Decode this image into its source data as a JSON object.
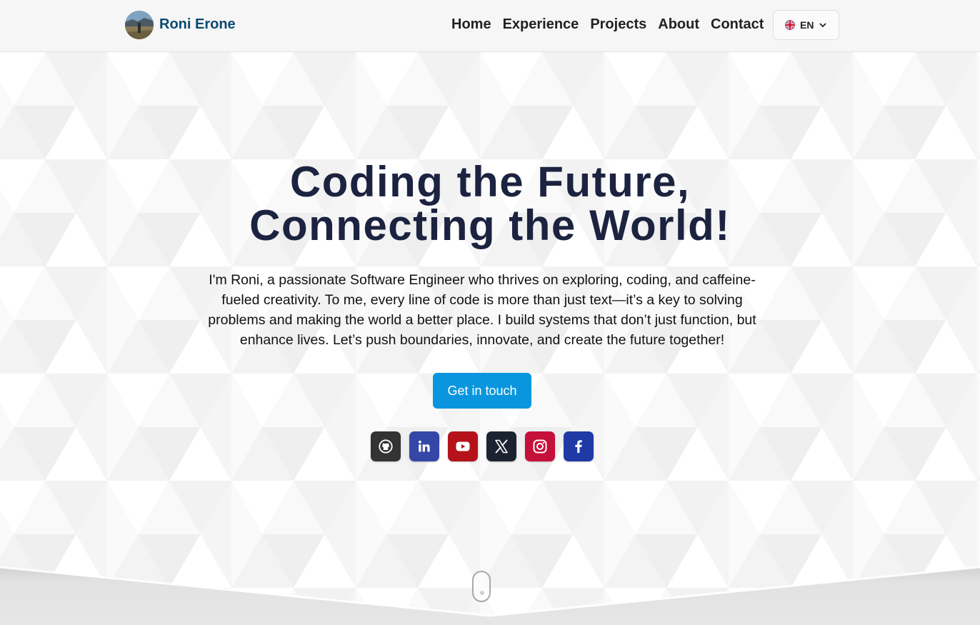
{
  "header": {
    "brand_name": "Roni Erone",
    "nav": [
      {
        "label": "Home"
      },
      {
        "label": "Experience"
      },
      {
        "label": "Projects"
      },
      {
        "label": "About"
      },
      {
        "label": "Contact"
      }
    ],
    "language": {
      "code": "EN",
      "flag": "uk-flag-icon"
    }
  },
  "hero": {
    "title_line1": "Coding the Future,",
    "title_line2": "Connecting the World!",
    "description": "I'm Roni, a passionate Software Engineer who thrives on exploring, coding, and caffeine-fueled creativity. To me, every line of code is more than just text—it’s a key to solving problems and making the world a better place. I build systems that don’t just function, but enhance lives. Let’s push boundaries, innovate, and create the future together!",
    "cta_label": "Get in touch"
  },
  "socials": [
    {
      "name": "github-icon",
      "color": "#333333"
    },
    {
      "name": "linkedin-icon",
      "color": "#3547a6"
    },
    {
      "name": "youtube-icon",
      "color": "#b5121b"
    },
    {
      "name": "x-icon",
      "color": "#1c2330"
    },
    {
      "name": "instagram-icon",
      "color": "#c4103a"
    },
    {
      "name": "facebook-icon",
      "color": "#1f3aa5"
    }
  ],
  "colors": {
    "brand": "#0b4a6f",
    "title": "#1c2340",
    "accent": "#0a96de"
  }
}
